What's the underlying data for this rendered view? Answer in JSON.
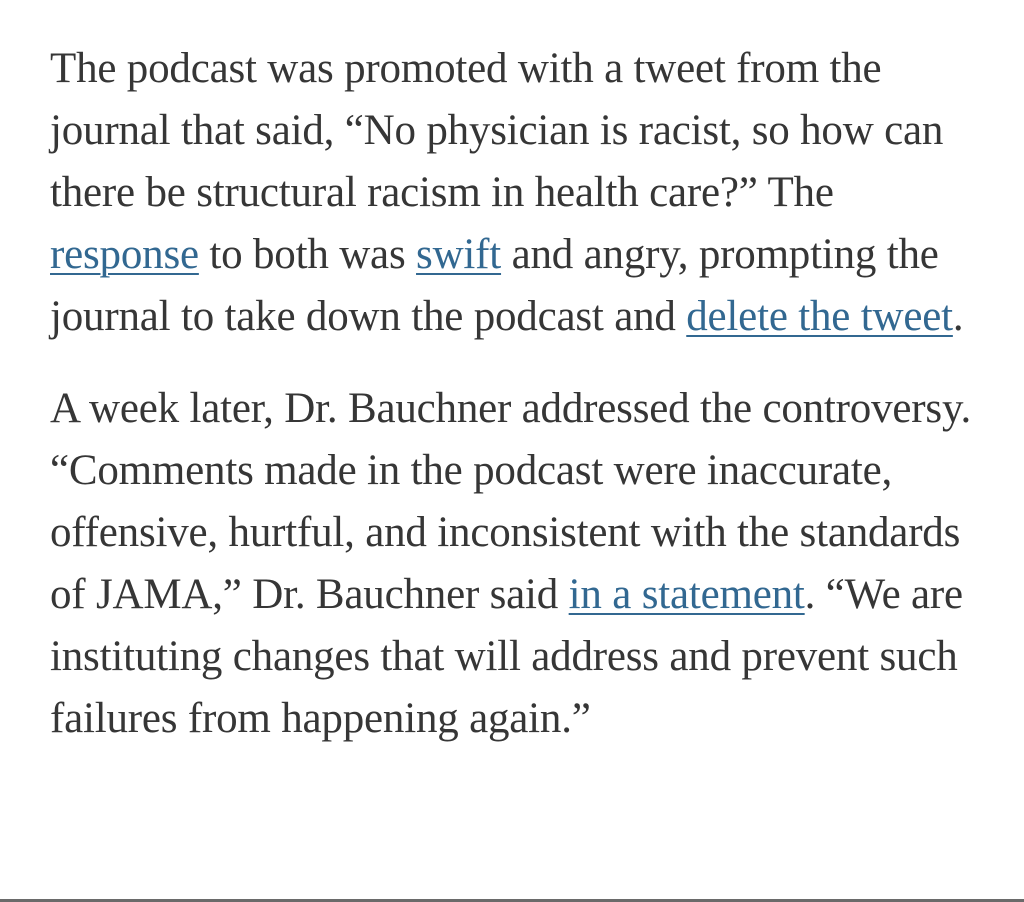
{
  "article": {
    "paragraphs": [
      {
        "segments": [
          {
            "text": "The podcast was promoted with a tweet from the journal that said, “No physician is racist, so how can there be structural racism in health care?” The "
          },
          {
            "text": "response",
            "link": true
          },
          {
            "text": " to both was "
          },
          {
            "text": "swift",
            "link": true
          },
          {
            "text": " and angry, prompting the journal to take down the podcast and "
          },
          {
            "text": "delete the tweet",
            "link": true
          },
          {
            "text": "."
          }
        ]
      },
      {
        "segments": [
          {
            "text": "A week later, Dr. Bauchner addressed the controversy. “Comments made in the podcast were inaccurate, offensive, hurtful, and inconsistent with the standards of JAMA,” Dr. Bauchner said "
          },
          {
            "text": "in a statement",
            "link": true
          },
          {
            "text": ". “We are instituting changes that will address and prevent such failures from happening again.”"
          }
        ]
      }
    ]
  },
  "colors": {
    "body_text": "#363636",
    "link": "#326891",
    "background": "#ffffff"
  }
}
